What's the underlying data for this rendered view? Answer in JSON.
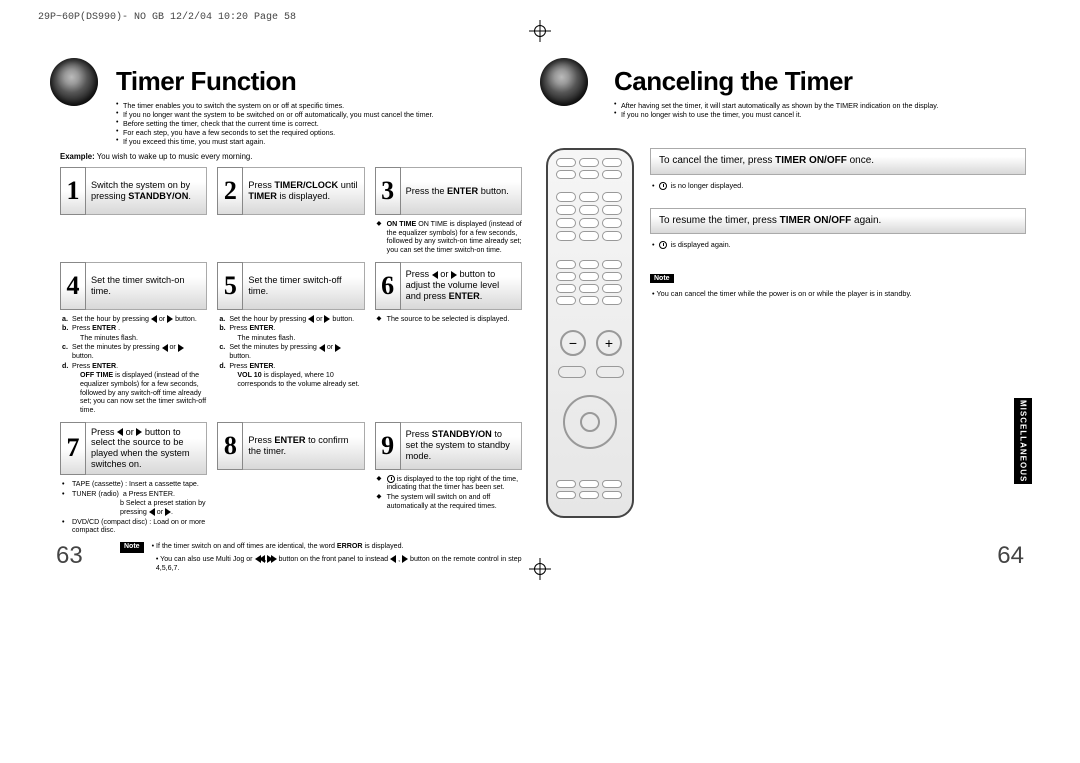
{
  "meta": {
    "header_strip": "29P~60P(DS990)- NO GB  12/2/04 10:20  Page 58"
  },
  "left_page": {
    "title": "Timer Function",
    "intro": {
      "l1": "The timer enables you to switch the system on or off at specific times.",
      "l2": "If you no longer want the system to be switched on or off automatically, you must cancel the timer.",
      "l3": "Before setting the timer, check that the current time is correct.",
      "l4": "For each step, you have a few seconds to set the required options.",
      "l4b": "If you exceed this time, you must start again."
    },
    "example_label": "Example:",
    "example_text": "You wish to wake up to music every morning.",
    "steps": {
      "s1": {
        "n": "1",
        "t_a": "Switch the system on by pressing ",
        "t_b": "STANDBY/ON",
        "t_c": "."
      },
      "s2": {
        "n": "2",
        "t_a": "Press ",
        "t_b": "TIMER/CLOCK",
        "t_c": " until ",
        "t_d": "TIMER",
        "t_e": " is displayed."
      },
      "s3": {
        "n": "3",
        "t_a": "Press the ",
        "t_b": "ENTER",
        "t_c": " button."
      },
      "s3_notes": {
        "a": "ON TIME is displayed (instead of the equalizer symbols) for a few seconds, followed by any switch-on time already set; you can set the timer switch-on time."
      },
      "s4": {
        "n": "4",
        "t": "Set the timer switch-on time."
      },
      "s4_notes": {
        "a_pre": "Set the hour by pressing ",
        "a_post": " button.",
        "b": "Press ENTER .",
        "b2": "The minutes flash.",
        "c_pre": "Set the minutes by pressing ",
        "c_post": " button.",
        "d": "Press ENTER.",
        "d2_pre": "OFF TIME",
        "d2_post": " is displayed (instead of the equalizer symbols) for a few seconds, followed by any switch-off time already set; you can now set the timer switch-off time."
      },
      "s5": {
        "n": "5",
        "t": "Set the timer switch-off time."
      },
      "s5_notes": {
        "a_pre": "Set the hour by pressing ",
        "a_post": " button.",
        "b": "Press ENTER.",
        "b2": "The minutes flash.",
        "c_pre": "Set the minutes by pressing ",
        "c_post": " button.",
        "d": "Press ENTER.",
        "d2_pre": "VOL 10",
        "d2_post": " is displayed, where 10 corresponds to the volume already set."
      },
      "s6": {
        "n": "6",
        "t_a": "Press ",
        "t_b": " or ",
        "t_c": " button to adjust the volume level and press ",
        "t_d": "ENTER",
        "t_e": "."
      },
      "s6_notes": {
        "a": "The source to be selected is displayed."
      },
      "s7": {
        "n": "7",
        "t_a": "Press ",
        "t_b": " or ",
        "t_c": " button to select the source to be played when the system switches on."
      },
      "s7_notes": {
        "l1_a": "TAPE (cassette) : Insert a cassette tape.",
        "l2_a": "TUNER (radio)",
        "l2_b": "a Press ENTER.",
        "l2_c_pre": "b Select a preset station by pressing ",
        "l2_c_post": ".",
        "l3_a": "DVD/CD (compact disc) : Load on or more compact disc."
      },
      "s8": {
        "n": "8",
        "t_a": "Press ",
        "t_b": "ENTER",
        "t_c": " to confirm the timer."
      },
      "s9": {
        "n": "9",
        "t_a": "Press ",
        "t_b": "STANDBY/ON",
        "t_c": " to set the system to standby mode."
      },
      "s9_notes": {
        "a": " is displayed to the top right of the time, indicating that the timer has been set.",
        "b": "The system will switch on and off automatically at the required times."
      }
    },
    "note_label": "Note",
    "foot1_pre": "If the timer switch on and off times are identical, the word ",
    "foot1_b": "ERROR",
    "foot1_post": " is displayed.",
    "foot2_pre": "You can also use Multi Jog or ",
    "foot2_mid": " button on the front panel to instead ",
    "foot2_post": " button on the remote control in step 4,5,6,7.",
    "pagenum": "63"
  },
  "right_page": {
    "title": "Canceling the Timer",
    "intro": {
      "l1": "After having set the timer, it will start automatically as shown by the TIMER indication on the display.",
      "l2": "If you no longer wish to use the timer, you must cancel it."
    },
    "c1_a": "To cancel the timer, press ",
    "c1_b": "TIMER ON/OFF",
    "c1_c": " once.",
    "c1_note": " is no longer displayed.",
    "c2_a": "To resume the timer, press ",
    "c2_b": "TIMER ON/OFF",
    "c2_c": " again.",
    "c2_note": " is displayed again.",
    "note_label": "Note",
    "note_text": "You can cancel the timer while the power is on or while the player is in standby.",
    "misc_tab": "MISCELLANEOUS",
    "pagenum": "64"
  }
}
